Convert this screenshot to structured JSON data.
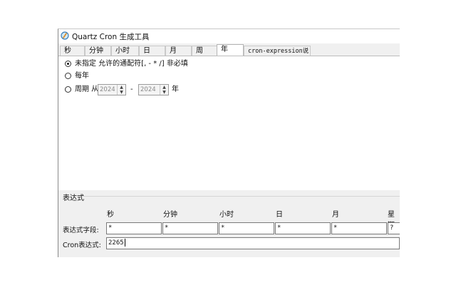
{
  "window": {
    "title": "Quartz Cron 生成工具",
    "icon": "app-logo-icon"
  },
  "tabs": [
    {
      "label": "秒"
    },
    {
      "label": "分钟"
    },
    {
      "label": "小时"
    },
    {
      "label": "日"
    },
    {
      "label": "月"
    },
    {
      "label": "周"
    },
    {
      "label": "年"
    },
    {
      "label": "cron-expression说明"
    }
  ],
  "active_tab": "年",
  "year_panel": {
    "option_unspecified": "未指定 允许的通配符[, - * /] 非必填",
    "option_every_year": "每年",
    "option_period": "周期 从",
    "period_from": "2024",
    "period_dash": "-",
    "period_to": "2024",
    "year_suffix": "年",
    "selected": "unspecified"
  },
  "expression": {
    "group_label": "表达式",
    "columns": [
      "秒",
      "分钟",
      "小时",
      "日",
      "月",
      "星期"
    ],
    "field_row_label": "表达式字段:",
    "fields": [
      "*",
      "*",
      "*",
      "*",
      "*",
      "?"
    ],
    "cron_label": "Cron表达式:",
    "cron_value": "2265"
  }
}
